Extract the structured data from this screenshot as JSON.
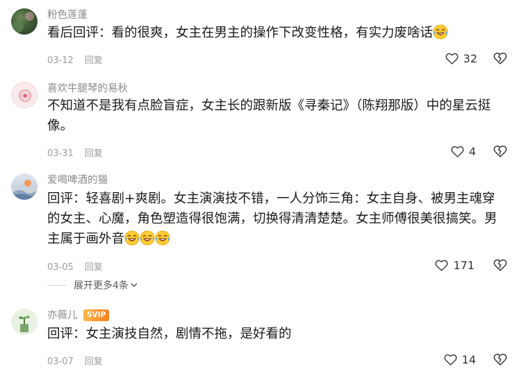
{
  "comments": [
    {
      "username": "粉色莲蓬",
      "text": "看后回评：看的很爽，女主在男主的操作下改变性格，有实力废啥话",
      "emoji_count": 1,
      "date": "03-12",
      "reply_label": "回复",
      "likes": "32"
    },
    {
      "username": "喜欢牛腿琴的易秋",
      "text": "不知道不是我有点脸盲症，女主长的跟新版《寻秦记》（陈翔那版）中的星云挺像。",
      "emoji_count": 0,
      "date": "03-31",
      "reply_label": "回复",
      "likes": "4"
    },
    {
      "username": "爱喝啤酒的猫",
      "text": "回评：轻喜剧+爽剧。女主演演技不错，一人分饰三角：女主自身、被男主魂穿的女主、心魔，角色塑造得很饱满，切换得清清楚楚。女主师傅很美很搞笑。男主属于画外音",
      "emoji_count": 3,
      "date": "03-05",
      "reply_label": "回复",
      "likes": "171",
      "expand_label": "展开更多4条"
    },
    {
      "username": "亦薇儿",
      "badge": "SVIP",
      "text": "回评：女主演技自然，剧情不拖，是好看的",
      "emoji_count": 0,
      "date": "03-07",
      "reply_label": "回复",
      "likes": "14"
    }
  ],
  "icons": {
    "like": "heart-outline-icon",
    "dislike": "broken-heart-icon",
    "emoji": "laughing-tears-emoji",
    "expand": "chevron-down-icon"
  },
  "colors": {
    "username": "#8a8a8a",
    "text": "#1a1a1a",
    "meta": "#9a9a9a",
    "badge_start": "#ffb648",
    "badge_end": "#ff7f1f"
  }
}
